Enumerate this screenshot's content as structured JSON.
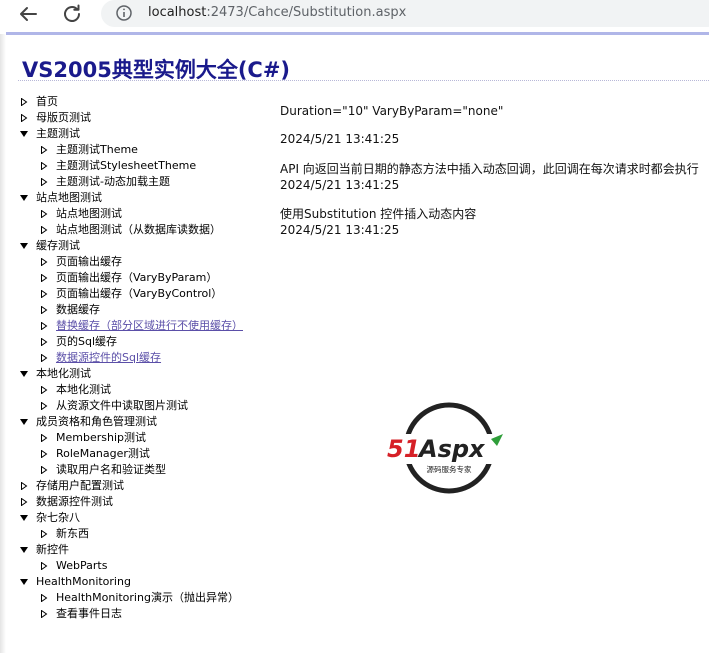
{
  "browser": {
    "url_host": "localhost",
    "url_rest": ":2473/Cahce/Substitution.aspx"
  },
  "page": {
    "title": "VS2005典型实例大全(C#)"
  },
  "tree": [
    {
      "label": "首页",
      "level": 0,
      "expanded": false,
      "link": false
    },
    {
      "label": "母版页测试",
      "level": 0,
      "expanded": false,
      "link": false
    },
    {
      "label": "主题测试",
      "level": 0,
      "expanded": true,
      "link": false
    },
    {
      "label": "主题测试Theme",
      "level": 1,
      "expanded": false,
      "link": false
    },
    {
      "label": "主题测试StylesheetTheme",
      "level": 1,
      "expanded": false,
      "link": false
    },
    {
      "label": "主题测试-动态加载主题",
      "level": 1,
      "expanded": false,
      "link": false
    },
    {
      "label": "站点地图测试",
      "level": 0,
      "expanded": true,
      "link": false
    },
    {
      "label": "站点地图测试",
      "level": 1,
      "expanded": false,
      "link": false
    },
    {
      "label": "站点地图测试（从数据库读数据）",
      "level": 1,
      "expanded": false,
      "link": false
    },
    {
      "label": "缓存测试",
      "level": 0,
      "expanded": true,
      "link": false
    },
    {
      "label": "页面输出缓存",
      "level": 1,
      "expanded": false,
      "link": false
    },
    {
      "label": "页面输出缓存（VaryByParam）",
      "level": 1,
      "expanded": false,
      "link": false
    },
    {
      "label": "页面输出缓存（VaryByControl）",
      "level": 1,
      "expanded": false,
      "link": false
    },
    {
      "label": "数据缓存",
      "level": 1,
      "expanded": false,
      "link": false
    },
    {
      "label": "替换缓存（部分区域进行不使用缓存）",
      "level": 1,
      "expanded": false,
      "link": true
    },
    {
      "label": "页的Sql缓存",
      "level": 1,
      "expanded": false,
      "link": false
    },
    {
      "label": "数据源控件的Sql缓存",
      "level": 1,
      "expanded": false,
      "link": true
    },
    {
      "label": "本地化测试",
      "level": 0,
      "expanded": true,
      "link": false
    },
    {
      "label": "本地化测试",
      "level": 1,
      "expanded": false,
      "link": false
    },
    {
      "label": "从资源文件中读取图片测试",
      "level": 1,
      "expanded": false,
      "link": false
    },
    {
      "label": "成员资格和角色管理测试",
      "level": 0,
      "expanded": true,
      "link": false
    },
    {
      "label": "Membership测试",
      "level": 1,
      "expanded": false,
      "link": false
    },
    {
      "label": "RoleManager测试",
      "level": 1,
      "expanded": false,
      "link": false
    },
    {
      "label": "读取用户名和验证类型",
      "level": 1,
      "expanded": false,
      "link": false
    },
    {
      "label": "存储用户配置测试",
      "level": 0,
      "expanded": false,
      "link": false
    },
    {
      "label": "数据源控件测试",
      "level": 0,
      "expanded": false,
      "link": false
    },
    {
      "label": "杂七杂八",
      "level": 0,
      "expanded": true,
      "link": false
    },
    {
      "label": "新东西",
      "level": 1,
      "expanded": false,
      "link": false
    },
    {
      "label": "新控件",
      "level": 0,
      "expanded": true,
      "link": false
    },
    {
      "label": "WebParts",
      "level": 1,
      "expanded": false,
      "link": false
    },
    {
      "label": "HealthMonitoring",
      "level": 0,
      "expanded": true,
      "link": false
    },
    {
      "label": "HealthMonitoring演示（抛出异常）",
      "level": 1,
      "expanded": false,
      "link": false
    },
    {
      "label": "查看事件日志",
      "level": 1,
      "expanded": false,
      "link": false
    }
  ],
  "content": {
    "lines": [
      "Duration=\"10\" VaryByParam=\"none\"",
      "2024/5/21 13:41:25",
      "API 向返回当前日期的静态方法中插入动态回调，此回调在每次请求时都会执行",
      "2024/5/21 13:41:25",
      "使用Substitution 控件插入动态内容",
      "2024/5/21 13:41:25"
    ]
  },
  "logo": {
    "brand_number": "51",
    "brand_name": "Aspx",
    "tagline": "源码服务专家",
    "colors": {
      "red": "#d62027",
      "green": "#2f9e3a",
      "dark": "#222222"
    }
  },
  "icons": [
    "back-arrow-icon",
    "reload-icon",
    "info-icon",
    "expanded-triangle-icon",
    "collapsed-triangle-icon"
  ]
}
